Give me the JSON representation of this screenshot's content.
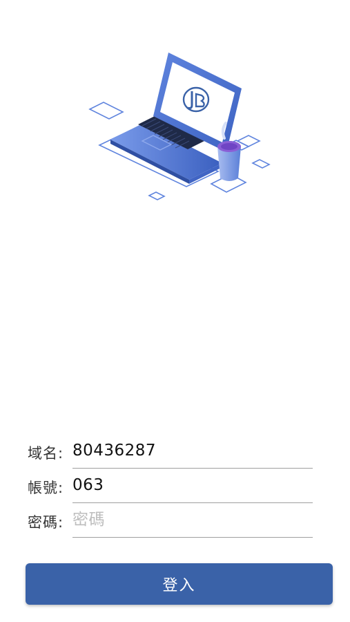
{
  "illustration": {
    "icon": "laptop-with-coffee-cup-icon",
    "accent": "#3a62a8",
    "light_accent": "#6b8fe0"
  },
  "form": {
    "domain": {
      "label": "域名:",
      "value": "80436287",
      "placeholder": ""
    },
    "account": {
      "label": "帳號:",
      "value": "063",
      "placeholder": ""
    },
    "password": {
      "label": "密碼:",
      "value": "",
      "placeholder": "密碼"
    }
  },
  "login_button": {
    "label": "登入",
    "color": "#3a62a8"
  }
}
